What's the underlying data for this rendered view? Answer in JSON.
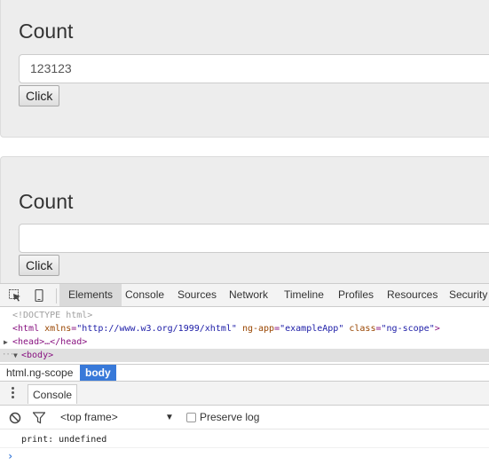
{
  "app": {
    "wells": [
      {
        "title": "Count",
        "input_value": "123123",
        "button_label": "Click"
      },
      {
        "title": "Count",
        "input_value": "",
        "button_label": "Click"
      }
    ]
  },
  "devtools": {
    "tabs": [
      "Elements",
      "Console",
      "Sources",
      "Network",
      "Timeline",
      "Profiles",
      "Resources",
      "Security"
    ],
    "active_tab": "Elements",
    "elements": {
      "doctype": "<!DOCTYPE html>",
      "html_open": "<html",
      "html_attr1_name": "xmlns",
      "html_attr1_value": "\"http://www.w3.org/1999/xhtml\"",
      "html_attr2_name": "ng-app",
      "html_attr2_value": "\"exampleApp\"",
      "html_attr3_name": "class",
      "html_attr3_value": "\"ng-scope\"",
      "html_close": ">",
      "head_node": "<head>…</head>",
      "body_node": "<body>"
    },
    "breadcrumbs": [
      "html.ng-scope",
      "body"
    ],
    "drawer": {
      "tab_label": "Console",
      "frame_select": "<top frame>",
      "preserve_log_label": "Preserve log",
      "log_line": "print: undefined",
      "prompt": "›"
    }
  },
  "colors": {
    "breadcrumb_active": "#3879d9",
    "tag": "#881280",
    "attr_name": "#994500",
    "attr_value": "#1a1aa6"
  }
}
